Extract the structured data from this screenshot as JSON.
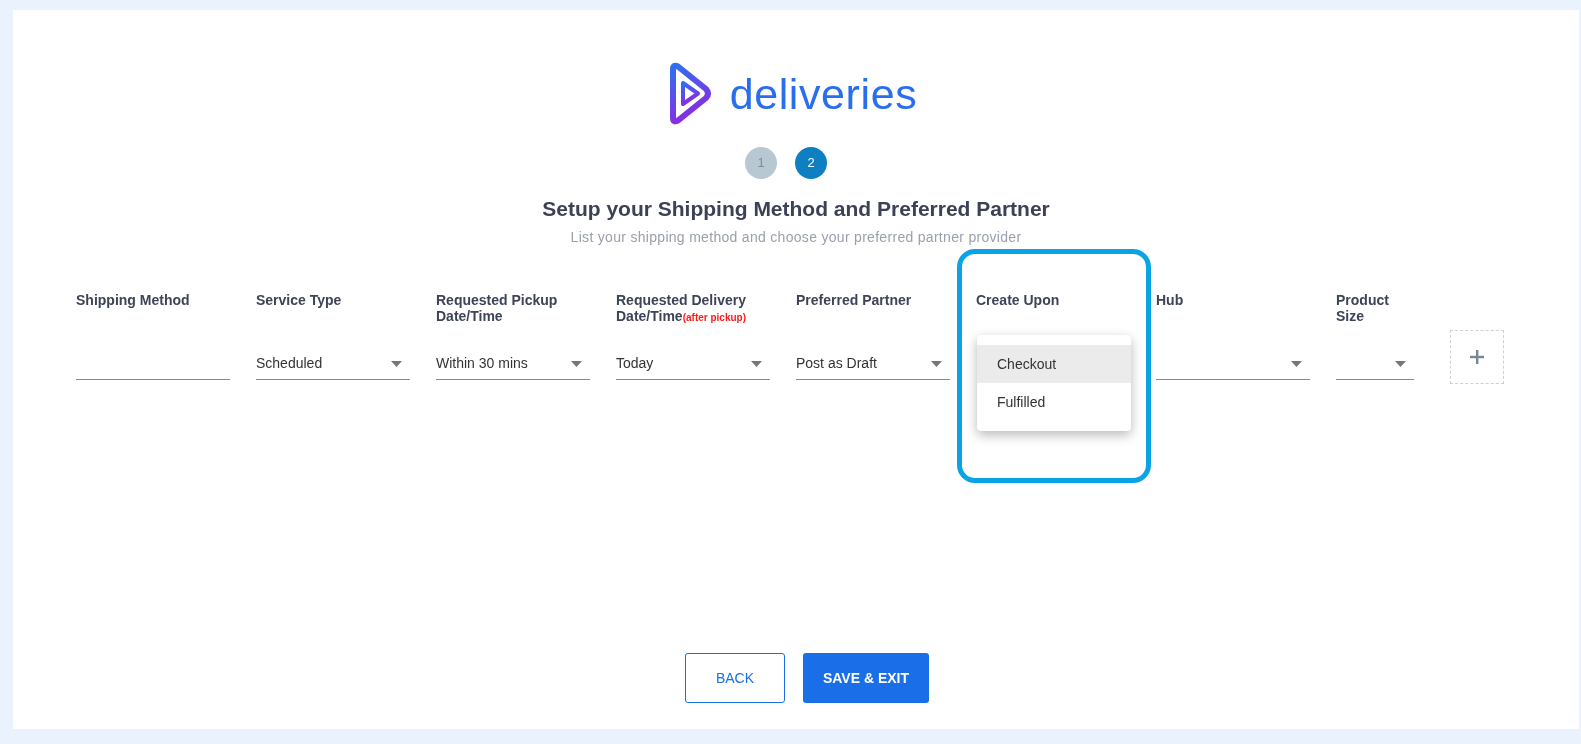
{
  "brand": {
    "name": "deliveries"
  },
  "steps": [
    {
      "label": "1",
      "selected": false
    },
    {
      "label": "2",
      "selected": true
    }
  ],
  "title": "Setup your Shipping Method and Preferred Partner",
  "subtitle": "List your shipping method and choose your preferred partner provider",
  "columns": [
    {
      "label": "Shipping Method",
      "kind": "text",
      "highlighted": false
    },
    {
      "label": "Service Type",
      "kind": "select",
      "value": "Scheduled",
      "highlighted": false
    },
    {
      "label": "Requested Pickup Date/Time",
      "kind": "select",
      "value": "Within 30 mins",
      "highlighted": false
    },
    {
      "label": "Requested Delivery Date/Time",
      "note": "(after pickup)",
      "kind": "select",
      "value": "Today",
      "highlighted": false
    },
    {
      "label": "Preferred Partner",
      "kind": "select",
      "value": "Post as Draft",
      "highlighted": false
    },
    {
      "label": "Create Upon",
      "kind": "menu",
      "highlighted": true,
      "options": [
        {
          "label": "Checkout",
          "selected": true
        },
        {
          "label": "Fulfilled",
          "selected": false
        }
      ]
    },
    {
      "label": "Hub",
      "kind": "select",
      "highlighted": false
    },
    {
      "label": "Product Size",
      "kind": "select",
      "highlighted": false
    }
  ],
  "actions": [
    {
      "label": "BACK",
      "kind": "outline"
    },
    {
      "label": "SAVE & EXIT",
      "kind": "primary"
    }
  ]
}
